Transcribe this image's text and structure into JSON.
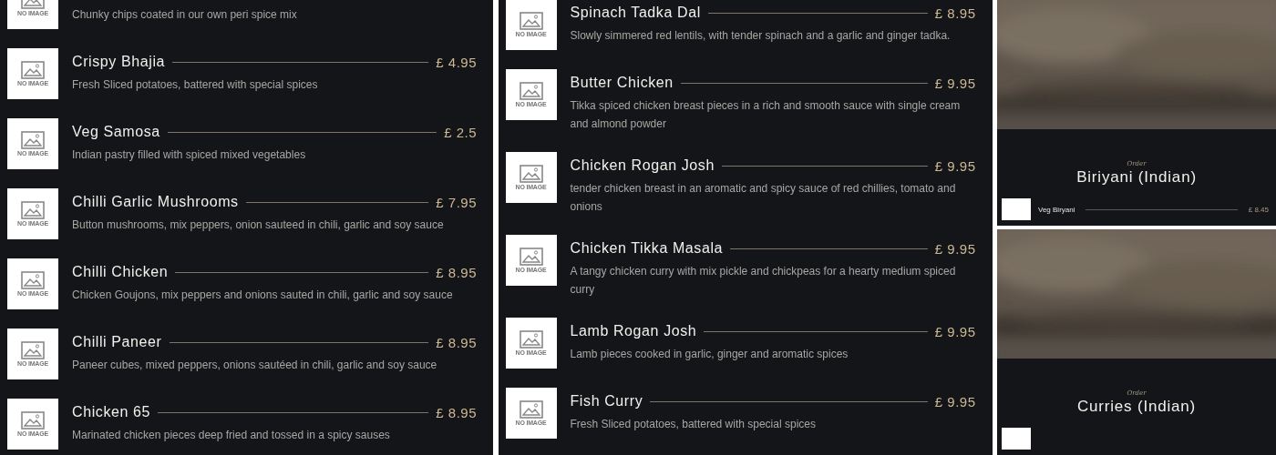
{
  "columns": [
    {
      "items": [
        {
          "kind": "cut",
          "image_label": "NO IMAGE",
          "description": "Chunky chips coated in our own peri spice mix"
        },
        {
          "kind": "full",
          "image_label": "NO IMAGE",
          "name": "Crispy Bhajia",
          "price": "£ 4.95",
          "description": "Fresh Sliced potatoes, battered with special spices"
        },
        {
          "kind": "full",
          "image_label": "NO IMAGE",
          "name": "Veg Samosa",
          "price": "£ 2.5",
          "description": "Indian pastry filled with spiced mixed vegetables"
        },
        {
          "kind": "full",
          "image_label": "NO IMAGE",
          "name": "Chilli Garlic Mushrooms",
          "price": "£ 7.95",
          "description": "Button mushrooms, mix peppers, onion sauteed in chili, garlic and soy sauce"
        },
        {
          "kind": "full",
          "image_label": "NO IMAGE",
          "name": "Chilli Chicken",
          "price": "£ 8.95",
          "description": "Chicken Goujons, mix peppers and onions sauted in chili, garlic and soy sauce"
        },
        {
          "kind": "full",
          "image_label": "NO IMAGE",
          "name": "Chilli Paneer",
          "price": "£ 8.95",
          "description": "Paneer cubes, mixed peppers, onions sautéed in chili, garlic and soy sauce"
        },
        {
          "kind": "full",
          "image_label": "NO IMAGE",
          "name": "Chicken 65",
          "price": "£ 8.95",
          "description": "Marinated chicken pieces deep fried and tossed in a spicy sauses"
        }
      ]
    },
    {
      "items": [
        {
          "kind": "full",
          "image_label": "NO IMAGE",
          "name": "Spinach Tadka Dal",
          "price": "£ 8.95",
          "description": "Slowly simmered red lentils, with tender spinach and a garlic and ginger tadka."
        },
        {
          "kind": "full",
          "image_label": "NO IMAGE",
          "name": "Butter Chicken",
          "price": "£ 9.95",
          "description": "Tikka spiced chicken breast pieces in a rich and smooth sauce with single cream and almond powder"
        },
        {
          "kind": "full",
          "image_label": "NO IMAGE",
          "name": "Chicken Rogan Josh",
          "price": "£ 9.95",
          "description": "tender chicken breast in an aromatic and spicy sauce of red chillies, tomato and onions"
        },
        {
          "kind": "full",
          "image_label": "NO IMAGE",
          "name": "Chicken Tikka Masala",
          "price": "£ 9.95",
          "description": "A tangy chicken curry with mix pickle and chickpeas for a hearty medium spiced curry"
        },
        {
          "kind": "full",
          "image_label": "NO IMAGE",
          "name": "Lamb Rogan Josh",
          "price": "£ 9.95",
          "description": "Lamb pieces cooked in garlic, ginger and aromatic spices"
        },
        {
          "kind": "full",
          "image_label": "NO IMAGE",
          "name": "Fish Curry",
          "price": "£ 9.95",
          "description": "Fresh Sliced potatoes, battered with special spices"
        }
      ]
    }
  ],
  "categories": [
    {
      "label": "Order",
      "title": "Biriyani (Indian)",
      "items": [
        {
          "kind": "full",
          "name": "Veg Biryani",
          "price": "£ 8.45"
        }
      ]
    },
    {
      "label": "Order",
      "title": "Curries (Indian)",
      "items": [
        {
          "kind": "tile"
        }
      ]
    }
  ]
}
